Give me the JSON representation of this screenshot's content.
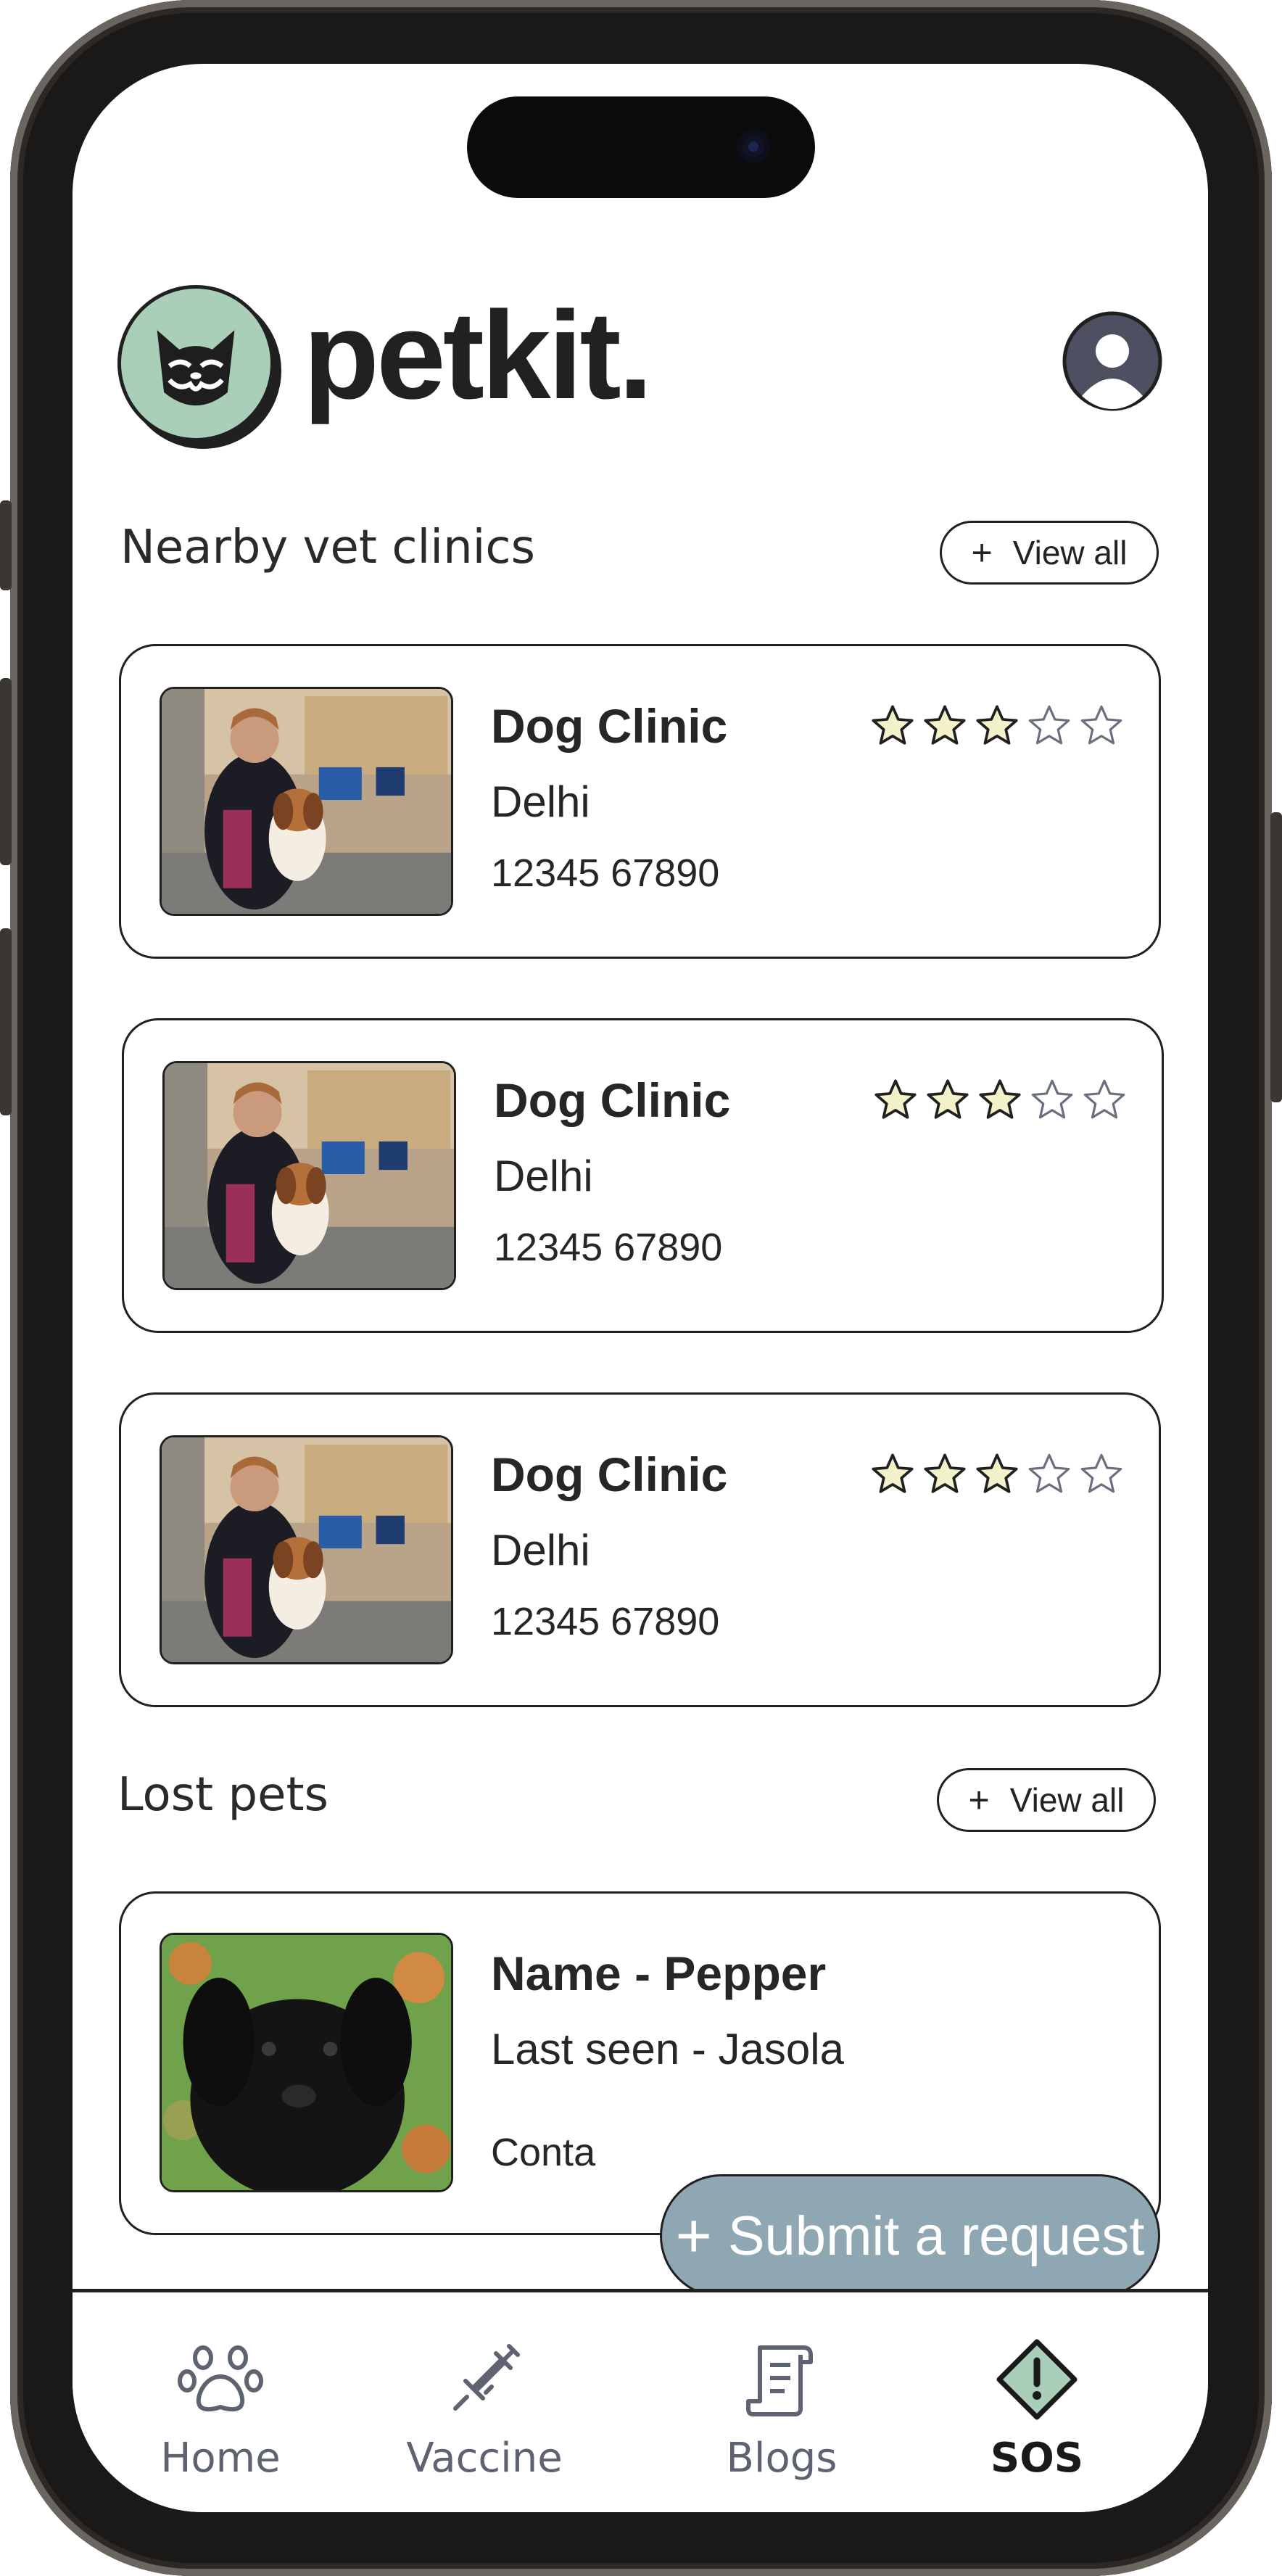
{
  "brand": {
    "name": "petkit."
  },
  "clinics": {
    "title": "Nearby vet clinics",
    "view_all": "View all",
    "items": [
      {
        "name": "Dog Clinic",
        "city": "Delhi",
        "phone": "12345 67890",
        "rating": 3,
        "max_rating": 5
      },
      {
        "name": "Dog Clinic",
        "city": "Delhi",
        "phone": "12345 67890",
        "rating": 3,
        "max_rating": 5
      },
      {
        "name": "Dog Clinic",
        "city": "Delhi",
        "phone": "12345 67890",
        "rating": 3,
        "max_rating": 5
      }
    ]
  },
  "lost": {
    "title": "Lost pets",
    "view_all": "View all",
    "items": [
      {
        "name": "Name - Pepper",
        "last_seen": "Last seen - Jasola",
        "contact": "Conta"
      }
    ]
  },
  "submit": {
    "label": "Submit a request"
  },
  "nav": {
    "items": [
      {
        "label": "Home",
        "icon": "paw-icon"
      },
      {
        "label": "Vaccine",
        "icon": "syringe-icon"
      },
      {
        "label": "Blogs",
        "icon": "scroll-icon"
      },
      {
        "label": "SOS",
        "icon": "alert-diamond-icon",
        "active": true
      }
    ]
  },
  "colors": {
    "logo_bg": "#a9cfb9",
    "star_fill": "#f2f1c9",
    "submit_bg": "#8ea7b2",
    "nav_muted": "#5d6370"
  }
}
